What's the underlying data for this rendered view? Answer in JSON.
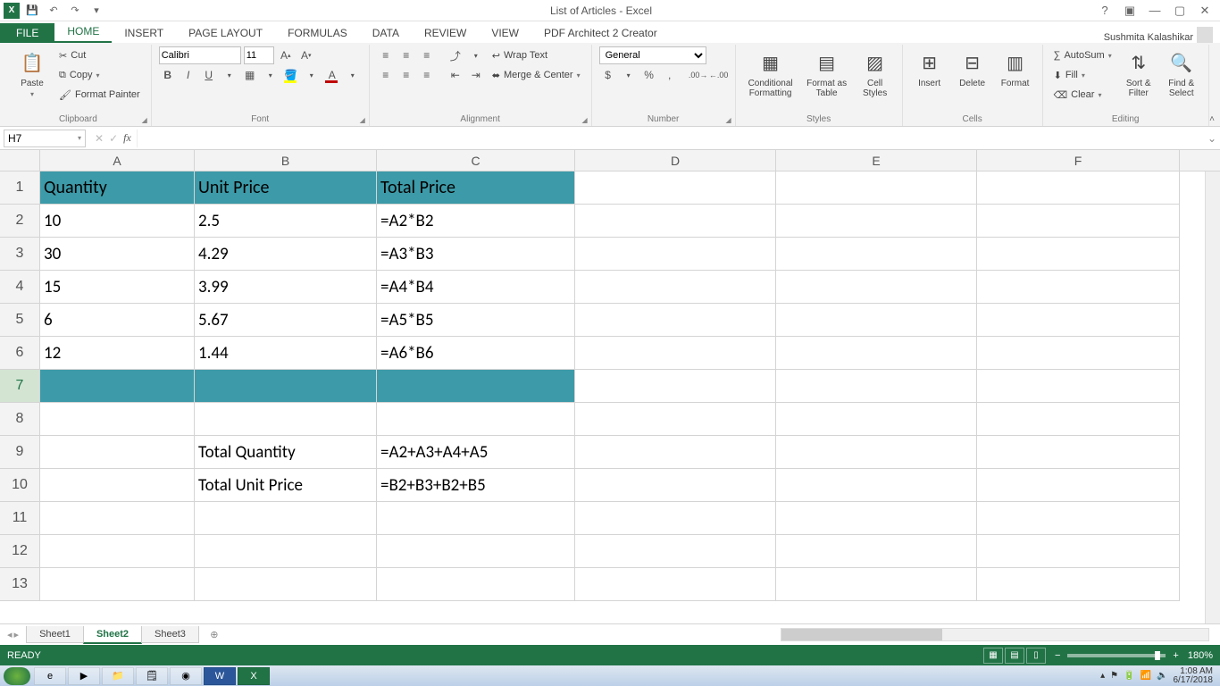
{
  "title": "List of Articles - Excel",
  "user": "Sushmita Kalashikar",
  "tabs": {
    "file": "FILE",
    "home": "HOME",
    "insert": "INSERT",
    "page_layout": "PAGE LAYOUT",
    "formulas": "FORMULAS",
    "data": "DATA",
    "review": "REVIEW",
    "view": "VIEW",
    "pdf": "PDF Architect 2 Creator"
  },
  "clipboard": {
    "paste": "Paste",
    "cut": "Cut",
    "copy": "Copy",
    "format_painter": "Format Painter",
    "label": "Clipboard"
  },
  "font": {
    "name": "Calibri",
    "size": "11",
    "label": "Font"
  },
  "alignment": {
    "wrap": "Wrap Text",
    "merge": "Merge & Center",
    "label": "Alignment"
  },
  "number": {
    "format": "General",
    "label": "Number"
  },
  "styles": {
    "cond": "Conditional Formatting",
    "table": "Format as Table",
    "cell": "Cell Styles",
    "label": "Styles"
  },
  "cells": {
    "insert": "Insert",
    "delete": "Delete",
    "format": "Format",
    "label": "Cells"
  },
  "editing": {
    "autosum": "AutoSum",
    "fill": "Fill",
    "clear": "Clear",
    "sort": "Sort & Filter",
    "find": "Find & Select",
    "label": "Editing"
  },
  "name_box": "H7",
  "columns": [
    "A",
    "B",
    "C",
    "D",
    "E",
    "F"
  ],
  "grid": {
    "r1": {
      "A": "Quantity",
      "B": "Unit Price",
      "C": "Total Price"
    },
    "r2": {
      "A": "10",
      "B": "2.5",
      "C": "=A2*B2"
    },
    "r3": {
      "A": "30",
      "B": "4.29",
      "C": "=A3*B3"
    },
    "r4": {
      "A": "15",
      "B": "3.99",
      "C": "=A4*B4"
    },
    "r5": {
      "A": "6",
      "B": "5.67",
      "C": "=A5*B5"
    },
    "r6": {
      "A": "12",
      "B": "1.44",
      "C": "=A6*B6"
    },
    "r9": {
      "B": "Total Quantity",
      "C": "=A2+A3+A4+A5"
    },
    "r10": {
      "B": "Total Unit Price",
      "C": "=B2+B3+B2+B5"
    }
  },
  "sheets": {
    "s1": "Sheet1",
    "s2": "Sheet2",
    "s3": "Sheet3"
  },
  "status": {
    "ready": "READY",
    "zoom": "180%"
  },
  "clock": {
    "time": "1:08 AM",
    "date": "6/17/2018"
  }
}
